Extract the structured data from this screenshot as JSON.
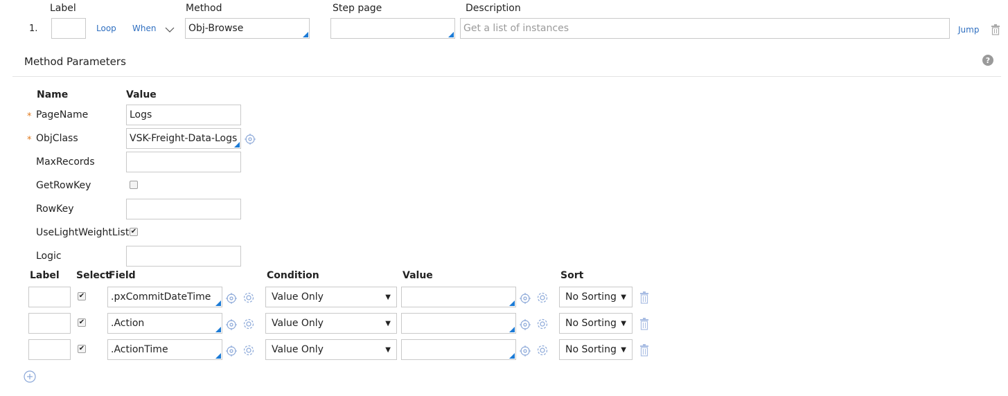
{
  "step": {
    "headers": {
      "label": "Label",
      "method": "Method",
      "step_page": "Step page",
      "description": "Description"
    },
    "number": "1.",
    "label_value": "",
    "loop_link": "Loop",
    "when_link": "When",
    "method_value": "Obj-Browse",
    "step_page_value": "",
    "description_placeholder": "Get a list of instances",
    "jump_link": "Jump"
  },
  "section": {
    "title": "Method Parameters"
  },
  "params": {
    "headers": {
      "name": "Name",
      "value": "Value"
    },
    "rows": [
      {
        "name": "PageName",
        "value": "Logs"
      },
      {
        "name": "ObjClass",
        "value": "VSK-Freight-Data-Logs"
      },
      {
        "name": "MaxRecords",
        "value": ""
      },
      {
        "name": "GetRowKey",
        "checked": false
      },
      {
        "name": "RowKey",
        "value": ""
      },
      {
        "name": "UseLightWeightList",
        "checked": true
      },
      {
        "name": "Logic",
        "value": ""
      }
    ],
    "required_marker": "*"
  },
  "fields": {
    "headers": {
      "label": "Label",
      "select": "Select",
      "field": "Field",
      "condition": "Condition",
      "value": "Value",
      "sort": "Sort"
    },
    "rows": [
      {
        "label": "",
        "selected": true,
        "field": ".pxCommitDateTime",
        "condition": "Value Only",
        "value": "",
        "sort": "No Sorting"
      },
      {
        "label": "",
        "selected": true,
        "field": ".Action",
        "condition": "Value Only",
        "value": "",
        "sort": "No Sorting"
      },
      {
        "label": "",
        "selected": true,
        "field": ".ActionTime",
        "condition": "Value Only",
        "value": "",
        "sort": "No Sorting"
      }
    ]
  },
  "colors": {
    "link": "#2f6fc0",
    "required": "#e07a1f",
    "smart_corner": "#1c7bd6",
    "icon": "#8aa7d8"
  }
}
